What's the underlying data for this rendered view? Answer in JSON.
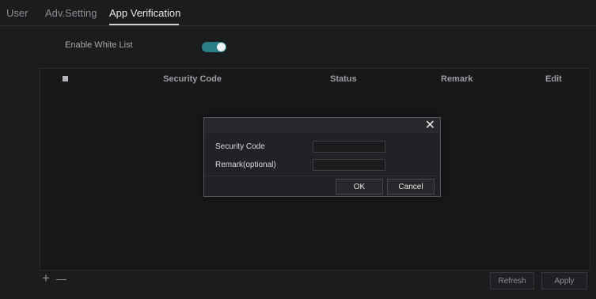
{
  "tabs": [
    {
      "label": "User"
    },
    {
      "label": "Adv.Setting"
    },
    {
      "label": "App Verification"
    }
  ],
  "white_list": {
    "label": "Enable White List",
    "enabled": true
  },
  "table": {
    "columns": [
      "Security Code",
      "Status",
      "Remark",
      "Edit"
    ]
  },
  "toolbar": {
    "add_icon": "+",
    "remove_icon": "—",
    "refresh_label": "Refresh",
    "apply_label": "Apply"
  },
  "dialog": {
    "close_icon": "✕",
    "security_code_label": "Security Code",
    "security_code_value": "",
    "remark_label": "Remark(optional)",
    "remark_value": "",
    "ok_label": "OK",
    "cancel_label": "Cancel"
  },
  "colors": {
    "background": "#1b1c1e",
    "toggle_accent": "#2a7f87"
  }
}
